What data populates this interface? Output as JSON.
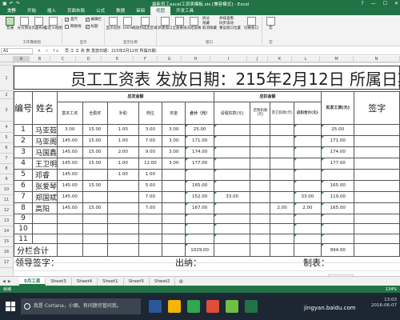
{
  "window": {
    "title": "最新员工excel工资表模板.xls [兼容模式] - Excel",
    "qat_icons": [
      "save-icon",
      "undo-icon",
      "redo-icon"
    ],
    "controls": [
      "?",
      "—",
      "☐",
      "✕"
    ]
  },
  "menu": {
    "tabs": [
      "文件",
      "开始",
      "插入",
      "页面布局",
      "公式",
      "数据",
      "审阅",
      "视图",
      "开发工具"
    ],
    "active": "视图"
  },
  "ribbon": {
    "workbook_views": {
      "buttons": [
        "普通",
        "分页预览",
        "页面布局",
        "自定义视图"
      ],
      "label": "工作簿视图"
    },
    "show": {
      "checks": [
        {
          "label": "直尺",
          "checked": true
        },
        {
          "label": "编辑栏",
          "checked": true
        },
        {
          "label": "网格线",
          "checked": false
        },
        {
          "label": "标题",
          "checked": true
        }
      ],
      "label": "显示"
    },
    "zoom": {
      "buttons": [
        "显示比例",
        "100%",
        "缩放到选定区域"
      ],
      "label": "显示比例"
    },
    "window": {
      "buttons": [
        "新建窗口",
        "全部重排",
        "冻结窗格"
      ],
      "small": [
        "拆分",
        "隐藏",
        "取消隐藏"
      ],
      "small2": [
        "并排查看",
        "同步滚动",
        "重设窗口位置"
      ],
      "switch": "切换窗口",
      "label": "窗口"
    },
    "macro": {
      "button": "宏",
      "label": "宏"
    }
  },
  "formula_bar": {
    "name_box": "A1",
    "fx": "✕ ✓ fx",
    "formula": "员 工 工 资 表    发放日期：215年2月12日  所属日期："
  },
  "columns": [
    "A",
    "B",
    "C",
    "D",
    "E",
    "F",
    "G",
    "H",
    "I",
    "J",
    "K",
    "L",
    "M",
    "N"
  ],
  "rows": [
    "1",
    "2",
    "3",
    "4",
    "5",
    "6",
    "7",
    "8",
    "9",
    "10",
    "11",
    "12",
    "13",
    "14",
    "15",
    "16",
    "17"
  ],
  "sheet": {
    "title": "员工工资表  发放日期：215年2月12日 所属日期",
    "header": {
      "no": "编号",
      "name": "姓名",
      "pay_group": "应发金额",
      "deduct_group": "应扣金额",
      "base": "基本工资",
      "full_attend": "全勤奖",
      "subsidy": "补助",
      "position": "岗位",
      "bonus": "奖金",
      "total": "合计（元）",
      "leave": "请假扣款(元)",
      "late": "迟到扣款(元)",
      "other": "其它扣款(元)",
      "deduct_total": "应扣合计(元)",
      "net": "实发工资(元)",
      "signature": "签字"
    },
    "rows": [
      {
        "no": "1",
        "name": "马亚茹",
        "base": "3.00",
        "full": "15.00",
        "subsidy": "1.00",
        "position": "3.00",
        "bonus": "3.00",
        "total": "25.00",
        "leave": "",
        "late": "",
        "other": "",
        "dtotal": "",
        "net": "25.00"
      },
      {
        "no": "2",
        "name": "马亚阁",
        "base": "145.00",
        "full": "15.00",
        "subsidy": "1.00",
        "position": "7.00",
        "bonus": "3.00",
        "total": "171.00",
        "leave": "",
        "late": "",
        "other": "",
        "dtotal": "",
        "net": "171.00"
      },
      {
        "no": "3",
        "name": "马国鑫",
        "base": "145.00",
        "full": "15.00",
        "subsidy": "2.00",
        "position": "9.00",
        "bonus": "3.00",
        "total": "174.00",
        "leave": "",
        "late": "",
        "other": "",
        "dtotal": "",
        "net": "174.00"
      },
      {
        "no": "4",
        "name": "王卫明",
        "base": "145.00",
        "full": "15.00",
        "subsidy": "1.00",
        "position": "12.00",
        "bonus": "3.00",
        "total": "177.00",
        "leave": "",
        "late": "",
        "other": "",
        "dtotal": "",
        "net": "177.00"
      },
      {
        "no": "5",
        "name": "邓睿",
        "base": "145.00",
        "full": "",
        "subsidy": "1.00",
        "position": "1.00",
        "bonus": "",
        "total": "",
        "leave": "",
        "late": "",
        "other": "",
        "dtotal": "",
        "net": ""
      },
      {
        "no": "6",
        "name": "张爱琴",
        "base": "145.00",
        "full": "15.00",
        "subsidy": "",
        "position": "5.00",
        "bonus": "",
        "total": "165.00",
        "leave": "",
        "late": "",
        "other": "",
        "dtotal": "",
        "net": "165.00"
      },
      {
        "no": "7",
        "name": "郑国斌",
        "base": "145.00",
        "full": "",
        "subsidy": "",
        "position": "7.00",
        "bonus": "",
        "total": "152.00",
        "leave": "33.00",
        "late": "",
        "other": "",
        "dtotal": "33.00",
        "net": "119.00"
      },
      {
        "no": "8",
        "name": "高阳",
        "base": "145.00",
        "full": "15.00",
        "subsidy": "",
        "position": "7.00",
        "bonus": "",
        "total": "167.00",
        "leave": "",
        "late": "",
        "other": "2.00",
        "dtotal": "2.00",
        "net": "165.00"
      },
      {
        "no": "9",
        "name": "",
        "base": "",
        "full": "",
        "subsidy": "",
        "position": "",
        "bonus": "",
        "total": "",
        "leave": "",
        "late": "",
        "other": "",
        "dtotal": "",
        "net": ""
      },
      {
        "no": "10",
        "name": "",
        "base": "",
        "full": "",
        "subsidy": "",
        "position": "",
        "bonus": "",
        "total": "",
        "leave": "",
        "late": "",
        "other": "",
        "dtotal": "",
        "net": ""
      },
      {
        "no": "11",
        "name": "",
        "base": "",
        "full": "",
        "subsidy": "",
        "position": "",
        "bonus": "",
        "total": "",
        "leave": "",
        "late": "",
        "other": "",
        "dtotal": "",
        "net": ""
      }
    ],
    "totals": {
      "label": "分栏合计",
      "total": "1029.00",
      "net": "994.00"
    },
    "signs": {
      "leader": "领导签字：",
      "cashier": "出纳：",
      "maker": "制表："
    }
  },
  "sheet_tabs": {
    "tabs": [
      "5月工资",
      "Sheet3",
      "Sheet4",
      "Sheet1",
      "Sheet5",
      "Sheet2"
    ],
    "active": "5月工资",
    "add": "⊕"
  },
  "status": {
    "text": "就绪",
    "zoom": "134%"
  },
  "taskbar": {
    "search": "我是 Cortana，小娜。有问题尽管问我。",
    "app_colors": [
      "#2b579a",
      "#f4b400",
      "#2fa84f",
      "#e04e39",
      "#6fbf44",
      "#217346"
    ],
    "time": "13:03",
    "date": "2016-06-07"
  },
  "watermark": "jingyan.baidu.com"
}
